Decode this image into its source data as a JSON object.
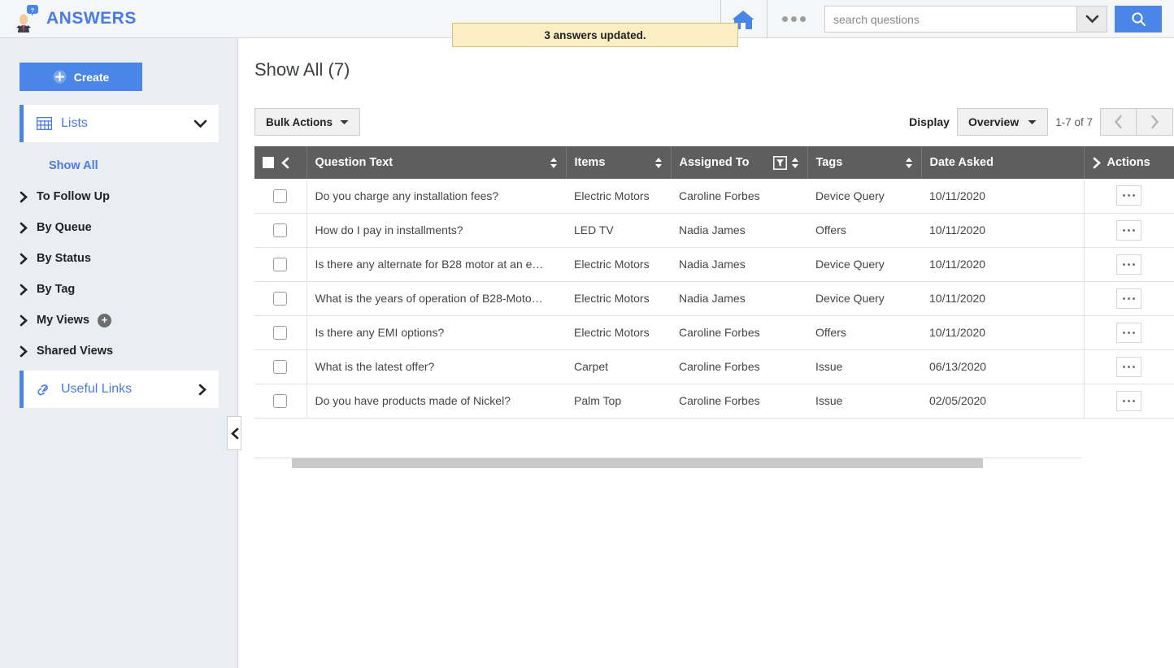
{
  "header": {
    "logo_text": "ANSWERS",
    "logo_icon": "person-question-icon",
    "home_icon": "home-icon",
    "more_icon": "three-dots-icon",
    "search_placeholder": "search questions",
    "search_value": "",
    "search_dropdown_icon": "chevron-down-icon",
    "search_button_icon": "search-icon"
  },
  "toast": {
    "message": "3 answers updated."
  },
  "sidebar": {
    "create_label": "Create",
    "create_icon": "plus-circle-icon",
    "section": {
      "label": "Lists",
      "icon": "grid-icon",
      "chevron": "chevron-down-icon"
    },
    "items": [
      {
        "label": "Show All",
        "active": true
      },
      {
        "label": "To Follow Up",
        "active": false
      },
      {
        "label": "By Queue",
        "active": false
      },
      {
        "label": "By Status",
        "active": false
      },
      {
        "label": "By Tag",
        "active": false
      },
      {
        "label": "My Views",
        "active": false,
        "add_icon": "plus-circle-icon"
      },
      {
        "label": "Shared Views",
        "active": false
      }
    ],
    "useful_links": {
      "label": "Useful Links",
      "icon": "link-icon",
      "chevron": "chevron-right-icon"
    },
    "collapse_icon": "chevron-left-icon"
  },
  "main": {
    "page_title": "Show All (7)",
    "bulk_actions_label": "Bulk Actions",
    "display_label": "Display",
    "display_value": "Overview",
    "range_text": "1-7 of 7",
    "prev_icon": "chevron-left-icon",
    "next_icon": "chevron-right-icon"
  },
  "table": {
    "columns": [
      {
        "label": "Question Text",
        "sortable": true,
        "filter": false
      },
      {
        "label": "Items",
        "sortable": true,
        "filter": false
      },
      {
        "label": "Assigned To",
        "sortable": true,
        "filter": true
      },
      {
        "label": "Tags",
        "sortable": true,
        "filter": false
      },
      {
        "label": "Date Asked",
        "sortable": false,
        "filter": false
      },
      {
        "label": "Actions",
        "sortable": false,
        "filter": false
      }
    ],
    "header_collapse_icon": "chevron-left-icon",
    "actions_expand_icon": "chevron-right-icon",
    "rows": [
      {
        "question": "Do you charge any installation fees?",
        "item": "Electric Motors",
        "assigned_to": "Caroline Forbes",
        "tag": "Device Query",
        "date_asked": "10/11/2020"
      },
      {
        "question": "How do I pay in installments?",
        "item": "LED TV",
        "assigned_to": "Nadia James",
        "tag": "Offers",
        "date_asked": "10/11/2020"
      },
      {
        "question": "Is there any alternate for B28 motor at an e…",
        "item": "Electric Motors",
        "assigned_to": "Nadia James",
        "tag": "Device Query",
        "date_asked": "10/11/2020"
      },
      {
        "question": "What is the years of operation of B28-Moto…",
        "item": "Electric Motors",
        "assigned_to": "Nadia James",
        "tag": "Device Query",
        "date_asked": "10/11/2020"
      },
      {
        "question": "Is there any EMI options?",
        "item": "Electric Motors",
        "assigned_to": "Caroline Forbes",
        "tag": "Offers",
        "date_asked": "10/11/2020"
      },
      {
        "question": "What is the latest offer?",
        "item": "Carpet",
        "assigned_to": "Caroline Forbes",
        "tag": "Issue",
        "date_asked": "06/13/2020"
      },
      {
        "question": "Do you have products made of Nickel?",
        "item": "Palm Top",
        "assigned_to": "Caroline Forbes",
        "tag": "Issue",
        "date_asked": "02/05/2020"
      }
    ]
  },
  "colors": {
    "accent_blue": "#4a86e8",
    "link_blue": "#4a79e8",
    "header_grey": "#5e5e5e",
    "sidebar_bg": "#eaeef2",
    "toast_bg": "#fbeec4",
    "toast_border": "#d7bf79"
  }
}
